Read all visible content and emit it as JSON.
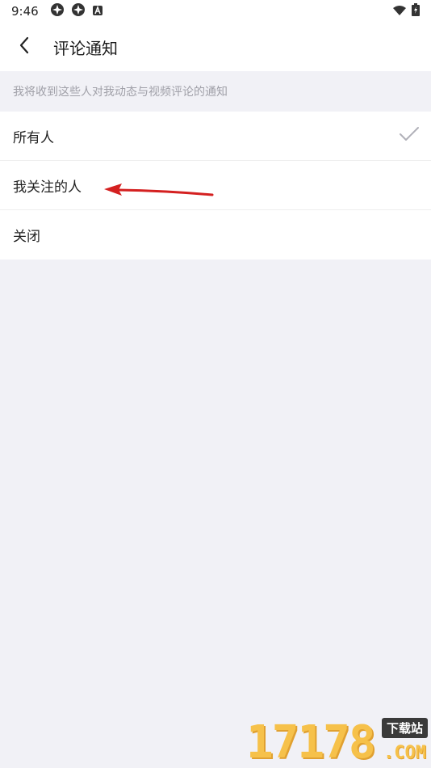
{
  "status_bar": {
    "time": "9:46",
    "left_icons": [
      "pinwheel-icon",
      "pinwheel-icon",
      "app-a-icon"
    ],
    "right_icons": [
      "wifi-icon",
      "battery-charging-icon"
    ]
  },
  "header": {
    "title": "评论通知",
    "back_icon": "chevron-left-icon"
  },
  "section": {
    "description": "我将收到这些人对我动态与视频评论的通知"
  },
  "options": [
    {
      "label": "所有人",
      "selected": true
    },
    {
      "label": "我关注的人",
      "selected": false
    },
    {
      "label": "关闭",
      "selected": false
    }
  ],
  "annotation": {
    "arrow_color": "#d42020",
    "points_to": "我关注的人"
  },
  "watermark": {
    "numbers": "17178",
    "brand": "下载站",
    "domain": ".COM"
  },
  "colors": {
    "background": "#f1f1f6",
    "surface": "#ffffff",
    "check": "#b0b0b8"
  }
}
